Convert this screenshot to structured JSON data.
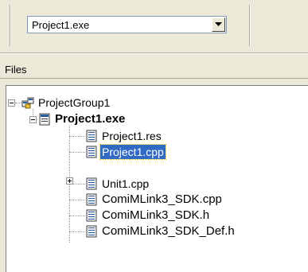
{
  "toolbar": {
    "project_combo_value": "Project1.exe"
  },
  "panel": {
    "title": "Files"
  },
  "tree": {
    "root": {
      "label": "ProjectGroup1",
      "icon": "project-group-icon",
      "expanded": true
    },
    "project": {
      "label": "Project1.exe",
      "icon": "project-icon",
      "expanded": true,
      "bold": true
    },
    "items": [
      {
        "label": "Project1.res",
        "icon": "source-file-icon",
        "selected": false,
        "expandable": false
      },
      {
        "label": "Project1.cpp",
        "icon": "source-file-icon",
        "selected": true,
        "expandable": false
      },
      {
        "label": "Unit1.cpp",
        "icon": "source-file-icon",
        "selected": false,
        "expandable": true
      },
      {
        "label": "ComiMLink3_SDK.cpp",
        "icon": "source-file-icon",
        "selected": false,
        "expandable": false
      },
      {
        "label": "ComiMLink3_SDK.h",
        "icon": "source-file-icon",
        "selected": false,
        "expandable": false
      },
      {
        "label": "ComiMLink3_SDK_Def.h",
        "icon": "source-file-icon",
        "selected": false,
        "expandable": false
      }
    ]
  },
  "colors": {
    "selection": "#316ac5",
    "chrome": "#ece9d8"
  }
}
